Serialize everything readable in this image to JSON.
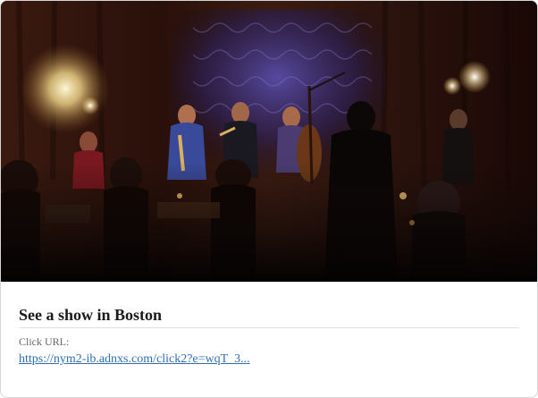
{
  "card": {
    "title": "See a show in Boston",
    "url_label": "Click URL:",
    "url_text": "https://nym2-ib.adnxs.com/click2?e=wqT_3..."
  },
  "image": {
    "subject": "jazz-band-on-stage-photo"
  },
  "colors": {
    "link": "#2f6fb4",
    "title": "#1a1a1a",
    "label": "#666666",
    "border": "#d6d6d6"
  }
}
